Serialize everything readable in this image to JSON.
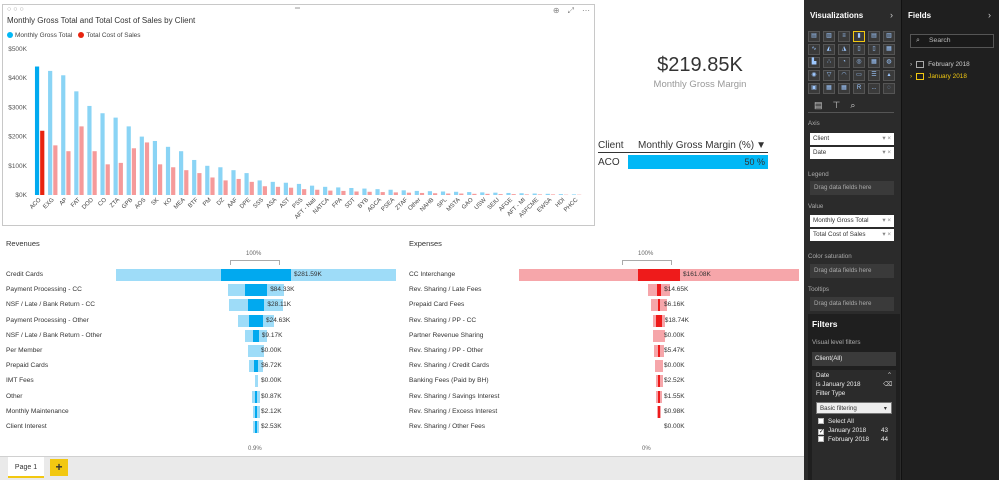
{
  "chart": {
    "title": "Monthly Gross Total and Total Cost of Sales by Client",
    "legend": [
      "Monthly Gross Total",
      "Total Cost of Sales"
    ],
    "colors": {
      "gross": "#8ad4f5",
      "cost": "#f59a9a",
      "gross_sel": "#00aaf0",
      "cost_sel": "#e8240f"
    }
  },
  "chart_data": {
    "type": "bar",
    "title": "Monthly Gross Total and Total Cost of Sales by Client",
    "categories": [
      "ACO",
      "EXG",
      "AP",
      "FAT",
      "DOD",
      "CO",
      "ZTA",
      "GPB",
      "AOS",
      "SK",
      "KO",
      "MEA",
      "BTF",
      "PM",
      "DZ",
      "AAF",
      "DPE",
      "SSS",
      "ASA",
      "AST",
      "PSS",
      "AFT - Nati",
      "NATCA",
      "FPA",
      "SDT",
      "BYB",
      "AGCA",
      "PSEA",
      "ZTAF",
      "Other",
      "NAHB",
      "SPL",
      "MSTA",
      "GAO",
      "USW",
      "SEIU",
      "AFGE",
      "AFT - MI",
      "ASFCME",
      "EWSA",
      "HDI",
      "PHCC"
    ],
    "series": [
      {
        "name": "Monthly Gross Total",
        "values": [
          440,
          425,
          410,
          355,
          305,
          280,
          265,
          235,
          200,
          185,
          165,
          150,
          120,
          100,
          95,
          85,
          75,
          50,
          45,
          42,
          38,
          32,
          28,
          26,
          24,
          22,
          20,
          18,
          16,
          14,
          13,
          12,
          11,
          10,
          9,
          8,
          7,
          6,
          5,
          4,
          3,
          2
        ]
      },
      {
        "name": "Total Cost of Sales",
        "values": [
          220,
          170,
          150,
          235,
          150,
          105,
          110,
          160,
          180,
          105,
          95,
          85,
          75,
          60,
          50,
          55,
          45,
          30,
          28,
          25,
          20,
          18,
          15,
          14,
          12,
          11,
          10,
          9,
          8,
          7,
          6,
          5,
          5,
          4,
          4,
          3,
          3,
          2,
          2,
          2,
          1,
          1
        ]
      }
    ],
    "ylim": [
      0,
      500
    ],
    "yticks": [
      "$0K",
      "$100K",
      "$200K",
      "$300K",
      "$400K",
      "$500K"
    ],
    "legend_position": "top-left",
    "grid": false
  },
  "kpi": {
    "value": "$219.85K",
    "label": "Monthly Gross Margin"
  },
  "margin_table": {
    "col1": "Client",
    "col2": "Monthly Gross Margin (%)",
    "client": "ACO",
    "value": "50 %"
  },
  "revenues": {
    "title": "Revenues",
    "top_pct": "100%",
    "bottom_pct": "0.9%",
    "rows": [
      {
        "label": "Credit Cards",
        "value": "$281.59K",
        "total": 1.0,
        "sel": 0.25
      },
      {
        "label": "Payment Processing - CC",
        "value": "$84.33K",
        "total": 0.2,
        "sel": 0.08
      },
      {
        "label": "NSF / Late / Bank Return - CC",
        "value": "$28.11K",
        "total": 0.19,
        "sel": 0.06
      },
      {
        "label": "Payment Processing - Other",
        "value": "$24.63K",
        "total": 0.13,
        "sel": 0.05
      },
      {
        "label": "NSF / Late / Bank Return - Other",
        "value": "$9.17K",
        "total": 0.08,
        "sel": 0.02
      },
      {
        "label": "Per Member",
        "value": "$0.00K",
        "total": 0.06,
        "sel": 0.0
      },
      {
        "label": "Prepaid Cards",
        "value": "$6.72K",
        "total": 0.05,
        "sel": 0.015
      },
      {
        "label": "IMT Fees",
        "value": "$0.00K",
        "total": 0.01,
        "sel": 0.0
      },
      {
        "label": "Other",
        "value": "$0.87K",
        "total": 0.03,
        "sel": 0.003
      },
      {
        "label": "Monthly Maintenance",
        "value": "$2.12K",
        "total": 0.025,
        "sel": 0.006
      },
      {
        "label": "Client Interest",
        "value": "$2.53K",
        "total": 0.02,
        "sel": 0.007
      }
    ]
  },
  "expenses": {
    "title": "Expenses",
    "top_pct": "100%",
    "bottom_pct": "0%",
    "rows": [
      {
        "label": "CC Interchange",
        "value": "$161.08K",
        "total": 1.0,
        "sel": 0.15
      },
      {
        "label": "Rev. Sharing / Late Fees",
        "value": "$14.65K",
        "total": 0.08,
        "sel": 0.015
      },
      {
        "label": "Prepaid Card Fees",
        "value": "$6.16K",
        "total": 0.06,
        "sel": 0.01
      },
      {
        "label": "Rev. Sharing / PP - CC",
        "value": "$18.74K",
        "total": 0.045,
        "sel": 0.02
      },
      {
        "label": "Partner Revenue Sharing",
        "value": "$0.00K",
        "total": 0.04,
        "sel": 0.0
      },
      {
        "label": "Rev. Sharing / PP - Other",
        "value": "$5.47K",
        "total": 0.035,
        "sel": 0.006
      },
      {
        "label": "Rev. Sharing / Credit Cards",
        "value": "$0.00K",
        "total": 0.03,
        "sel": 0.0
      },
      {
        "label": "Banking Fees (Paid by BH)",
        "value": "$2.52K",
        "total": 0.025,
        "sel": 0.003
      },
      {
        "label": "Rev. Sharing / Savings Interest",
        "value": "$1.55K",
        "total": 0.02,
        "sel": 0.002
      },
      {
        "label": "Rev. Sharing / Excess Interest",
        "value": "$0.98K",
        "total": 0.015,
        "sel": 0.001
      },
      {
        "label": "Rev. Sharing / Other Fees",
        "value": "$0.00K",
        "total": 0.0,
        "sel": 0.0
      }
    ]
  },
  "pages": {
    "tab": "Page 1",
    "add": "+"
  },
  "viz": {
    "title": "Visualizations",
    "icon_r": "R",
    "more": "...",
    "sections": {
      "axis": "Axis",
      "legend": "Legend",
      "value": "Value",
      "color_sat": "Color saturation",
      "tooltips": "Tooltips"
    },
    "axis_fields": [
      "Client",
      "Date"
    ],
    "value_fields": [
      "Monthly Gross Total",
      "Total Cost of Sales"
    ],
    "drop": "Drag data fields here"
  },
  "filters": {
    "title": "Filters",
    "visual_level": "Visual level filters",
    "client": "Client(All)",
    "date": "Date",
    "date_cond": "is January 2018",
    "filter_type": "Filter Type",
    "filter_mode": "Basic filtering",
    "select_all": "Select All",
    "options": [
      {
        "label": "January 2018",
        "count": "43",
        "checked": true
      },
      {
        "label": "February 2018",
        "count": "44",
        "checked": false
      }
    ]
  },
  "fields": {
    "title": "Fields",
    "search_placeholder": "Search",
    "tables": [
      {
        "label": "February 2018",
        "color": "#e0e0e0"
      },
      {
        "label": "January 2018",
        "color": "#f2c811"
      }
    ]
  }
}
